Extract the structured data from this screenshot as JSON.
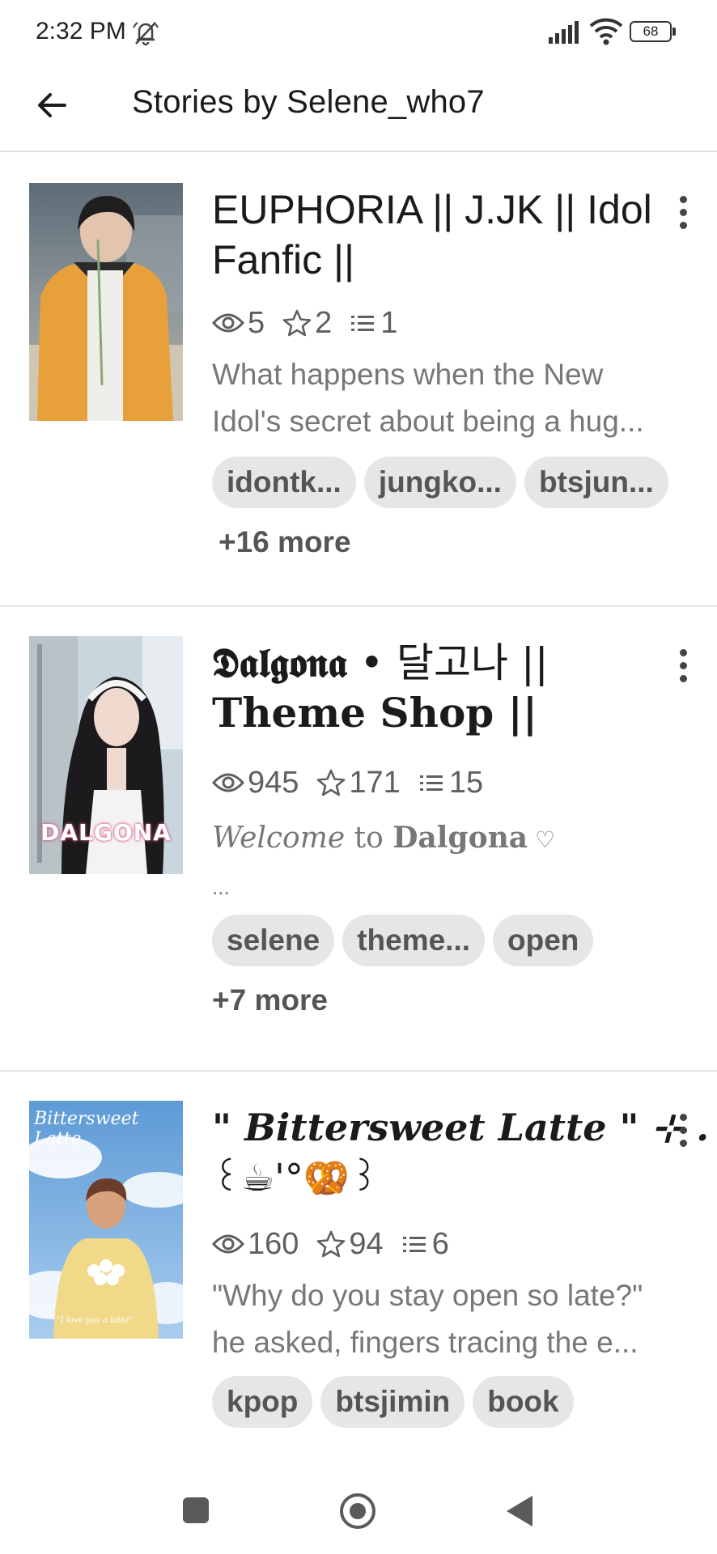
{
  "status_bar": {
    "time": "2:32 PM",
    "battery": "68"
  },
  "app_bar": {
    "title": "Stories by Selene_who7"
  },
  "stories": [
    {
      "title": "EUPHORIA || J.JK || Idol Fanfic ||",
      "reads": "5",
      "votes": "2",
      "parts": "1",
      "description_line1": "What happens when the New",
      "description_line2": "Idol's secret about being a hug...",
      "tags": [
        "idontk...",
        "jungko...",
        "btsjun..."
      ],
      "more_tags": "+16 more",
      "colors": {
        "jacket": "#e8a13a",
        "background": "#7e8a8f"
      }
    },
    {
      "title_styled": "𝕯𝖆𝖑𝖌𝖔𝖓𝖆",
      "title_rest": " • 달고나 ||",
      "title_line2": "Theme Shop ||",
      "reads": "945",
      "votes": "171",
      "parts": "15",
      "description_italic": "Welcome",
      "description_mid": " to ",
      "description_bold": "Dalgona",
      "description_heart": " ♡",
      "description_line2": "...",
      "cover_text": "DALGONA",
      "tags": [
        "selene",
        "theme...",
        "open"
      ],
      "more_tags": "+7 more"
    },
    {
      "title_line1": "\" Bittersweet Latte \" ⊹ . ‹",
      "title_line2": "꒰☕'°🥨꒱",
      "reads": "160",
      "votes": "94",
      "parts": "6",
      "description_line1": "\"Why do you stay open so late?\"",
      "description_line2": "he asked, fingers tracing the e...",
      "cover_title": "Bittersweet Latte",
      "cover_caption": "\"I love you a latte\"",
      "tags": [
        "kpop",
        "btsjimin",
        "book"
      ]
    }
  ],
  "icons": [
    "back-arrow-icon",
    "eye-icon",
    "star-icon",
    "list-icon",
    "more-vert-icon"
  ]
}
